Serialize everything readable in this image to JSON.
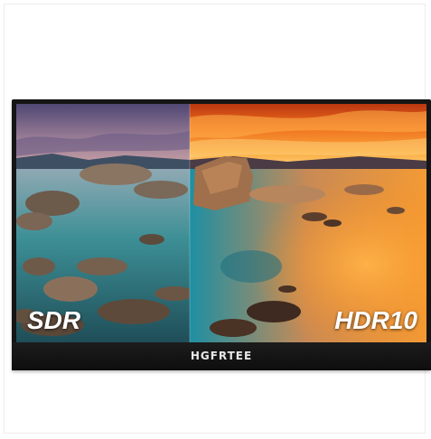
{
  "image": {
    "brand": "HGFRTEE",
    "left_label": "SDR",
    "right_label": "HDR10"
  },
  "colors": {
    "sdr_sky_top": "#5a4f7a",
    "sdr_sky_bottom": "#c79aa4",
    "sdr_water": "#2f8f93",
    "hdr_sky_top": "#d8541a",
    "hdr_sky_mid": "#f7a236",
    "hdr_water": "#2aa6b8",
    "hdr_glow": "#ff9b2e",
    "bezel": "#151515"
  }
}
